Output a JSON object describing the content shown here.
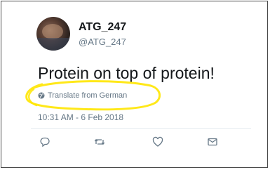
{
  "tweet": {
    "author_name": "ATG_247",
    "author_handle": "@ATG_247",
    "text": "Protein on top of protein!",
    "translate_label": "Translate from German",
    "timestamp": "10:31 AM - 6 Feb 2018"
  },
  "actions": [
    "reply-icon",
    "retweet-icon",
    "like-icon",
    "direct-message-icon"
  ],
  "colors": {
    "text": "#14171a",
    "secondary": "#657786",
    "highlight": "#ffe600"
  }
}
